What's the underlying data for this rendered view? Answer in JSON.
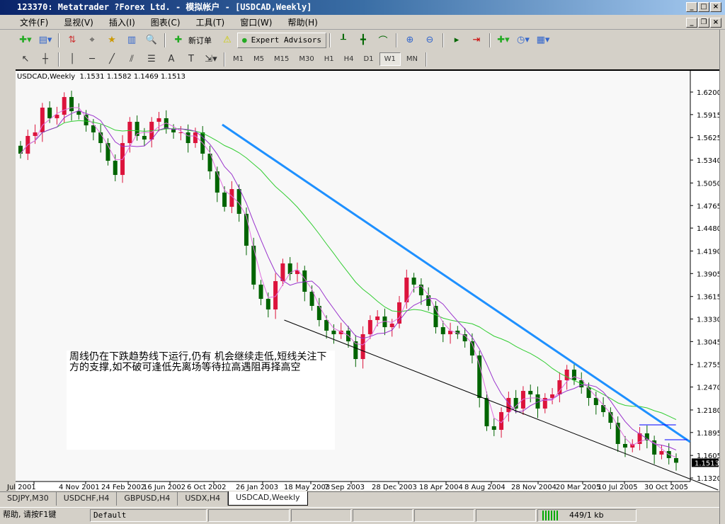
{
  "window": {
    "title": "123370: Metatrader ?Forex Ltd. - 模拟帐户 - [USDCAD,Weekly]"
  },
  "menu": [
    "文件(F)",
    "显视(V)",
    "插入(I)",
    "图表(C)",
    "工具(T)",
    "窗口(W)",
    "帮助(H)"
  ],
  "toolbar": {
    "new_order": "新订单",
    "expert_advisors": "Expert Advisors"
  },
  "timeframes": [
    "M1",
    "M5",
    "M15",
    "M30",
    "H1",
    "H4",
    "D1",
    "W1",
    "MN"
  ],
  "active_timeframe": "W1",
  "chart_header": {
    "symbol": "USDCAD,Weekly",
    "ohlc": "1.1531 1.1582 1.1469 1.1513"
  },
  "annotation": "周线仍在下跌趋势线下运行,仍有 机会继续走低,短线关注下方的支撑,如不破可逢低先离场等待拉高遇阻再择高空",
  "tabs": [
    "SDJPY,M30",
    "USDCHF,H4",
    "GBPUSD,H4",
    "USDX,H4",
    "USDCAD,Weekly"
  ],
  "active_tab": "USDCAD,Weekly",
  "status": {
    "help": "帮助, 请按F1键",
    "profile": "Default",
    "traffic": "449/1 kb"
  },
  "colors": {
    "bull": "#dc143c",
    "bear": "#006400",
    "ma_fast": "#e070e0",
    "ma_mid": "#9932cc",
    "ma_slow": "#32cd32",
    "trendline_upper": "#1e90ff",
    "trendline_lower": "#000000",
    "level_lines": "#0000ff",
    "background": "#f8f8f8"
  },
  "chart_data": {
    "type": "candlestick",
    "symbol": "USDCAD",
    "timeframe": "Weekly",
    "ylim": [
      1.132,
      1.62
    ],
    "y_ticks": [
      "1.6200",
      "1.5915",
      "1.5625",
      "1.5340",
      "1.5050",
      "1.4765",
      "1.4480",
      "1.4190",
      "1.3905",
      "1.3615",
      "1.3330",
      "1.3045",
      "1.2755",
      "1.2470",
      "1.2180",
      "1.1895",
      "1.1605",
      "1.1320"
    ],
    "current_price": "1.1513",
    "x_ticks": [
      "Jul 2001",
      "4 Nov 2001",
      "24 Feb 2002",
      "16 Jun 2002",
      "6 Oct 2002",
      "26 Jan 2003",
      "18 May 2003",
      "7 Sep 2003",
      "28 Dec 2003",
      "18 Apr 2004",
      "8 Aug 2004",
      "28 Nov 2004",
      "20 Mar 2005",
      "10 Jul 2005",
      "30 Oct 2005"
    ],
    "closes": [
      1.5421,
      1.5645,
      1.569,
      1.6003,
      1.5869,
      1.5913,
      1.6137,
      1.5958,
      1.5913,
      1.5779,
      1.569,
      1.5555,
      1.5331,
      1.5152,
      1.5555,
      1.5824,
      1.5645,
      1.56,
      1.5824,
      1.5869,
      1.5734,
      1.569,
      1.569,
      1.5555,
      1.569,
      1.5421,
      1.5197,
      1.4929,
      1.4749,
      1.4973,
      1.466,
      1.4257,
      1.3765,
      1.3585,
      1.3451,
      1.3809,
      1.4033,
      1.3899,
      1.3944,
      1.3675,
      1.3496,
      1.3317,
      1.3183,
      1.3138,
      1.3183,
      1.3048,
      1.2824,
      1.3138,
      1.3317,
      1.3362,
      1.3227,
      1.3272,
      1.3541,
      1.3854,
      1.3765,
      1.363,
      1.3496,
      1.3227,
      1.3138,
      1.3183,
      1.3138,
      1.3048,
      1.2869,
      1.2332,
      1.1974,
      1.1929,
      1.2153,
      1.2332,
      1.2198,
      1.2421,
      1.2377,
      1.2198,
      1.2332,
      1.2377,
      1.2556,
      1.269,
      1.2556,
      1.2466,
      1.2332,
      1.2242,
      1.2153,
      1.2018,
      1.175,
      1.1705,
      1.175,
      1.1884,
      1.1795,
      1.1616,
      1.166,
      1.1571,
      1.1513
    ],
    "trendlines": [
      {
        "kind": "upper",
        "from": {
          "date": "2002-11-10",
          "price": 1.5788
        },
        "to": {
          "date": "2006-01-15",
          "price": 1.1777
        }
      },
      {
        "kind": "lower",
        "from": {
          "date": "2003-04-13",
          "price": 1.3317
        },
        "to": {
          "date": "2006-03-26",
          "price": 1.1168
        }
      },
      {
        "kind": "level",
        "from": {
          "date": "2005-09-11",
          "price": 1.1992
        },
        "to": {
          "date": "2005-12-11",
          "price": 1.1992
        }
      },
      {
        "kind": "level",
        "from": {
          "date": "2005-11-13",
          "price": 1.1804
        },
        "to": {
          "date": "2006-01-08",
          "price": 1.1804
        }
      }
    ]
  }
}
